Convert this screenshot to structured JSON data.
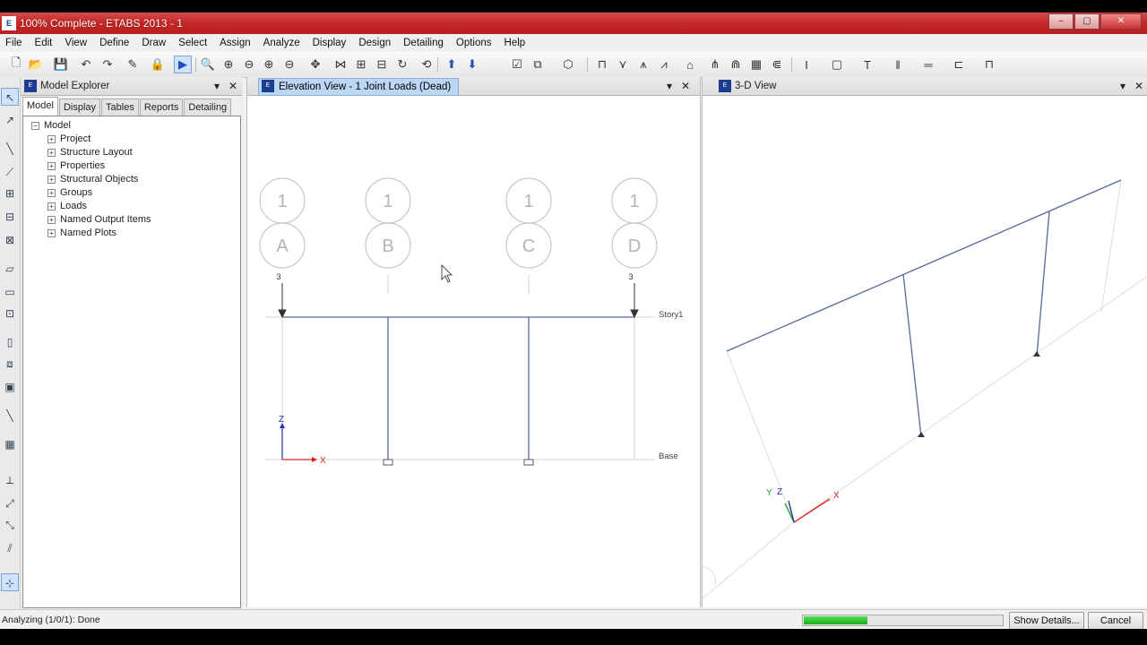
{
  "window": {
    "title": "100% Complete - ETABS 2013 - 1",
    "icon": "etabs-app-icon",
    "app_icon_text": "E"
  },
  "window_controls": {
    "minimize": "–",
    "maximize": "▢",
    "close": "✕"
  },
  "menu": [
    "File",
    "Edit",
    "View",
    "Define",
    "Draw",
    "Select",
    "Assign",
    "Analyze",
    "Display",
    "Design",
    "Detailing",
    "Options",
    "Help"
  ],
  "explorer": {
    "title": "Model Explorer",
    "tabs": [
      "Model",
      "Display",
      "Tables",
      "Reports",
      "Detailing"
    ],
    "active_tab": "Model",
    "root": "Model",
    "items": [
      "Project",
      "Structure Layout",
      "Properties",
      "Structural Objects",
      "Groups",
      "Loads",
      "Named Output Items",
      "Named Plots"
    ]
  },
  "panel_controls": {
    "pin": "▾",
    "close": "✕",
    "expand": "+",
    "collapse": "−"
  },
  "elevation_view": {
    "title": "Elevation View - 1  Joint Loads (Dead)",
    "grid_top": [
      "1",
      "1",
      "1",
      "1"
    ],
    "grid_letters": [
      "A",
      "B",
      "C",
      "D"
    ],
    "load_values": [
      "3",
      "3"
    ],
    "story_labels": [
      "Story1",
      "Base"
    ],
    "axis_labels": {
      "z": "Z",
      "x": "X"
    }
  },
  "threed_view": {
    "title": "3-D View",
    "axis_labels": {
      "x": "X",
      "y": "Y",
      "z": "Z"
    }
  },
  "status": {
    "text": "Analyzing (1/0/1): Done",
    "progress": 0.32,
    "show_details": "Show Details...",
    "cancel": "Cancel"
  },
  "colors": {
    "titlebar": "#c52a2a",
    "progress": "#22c222",
    "frame": "#5a6a9a"
  }
}
